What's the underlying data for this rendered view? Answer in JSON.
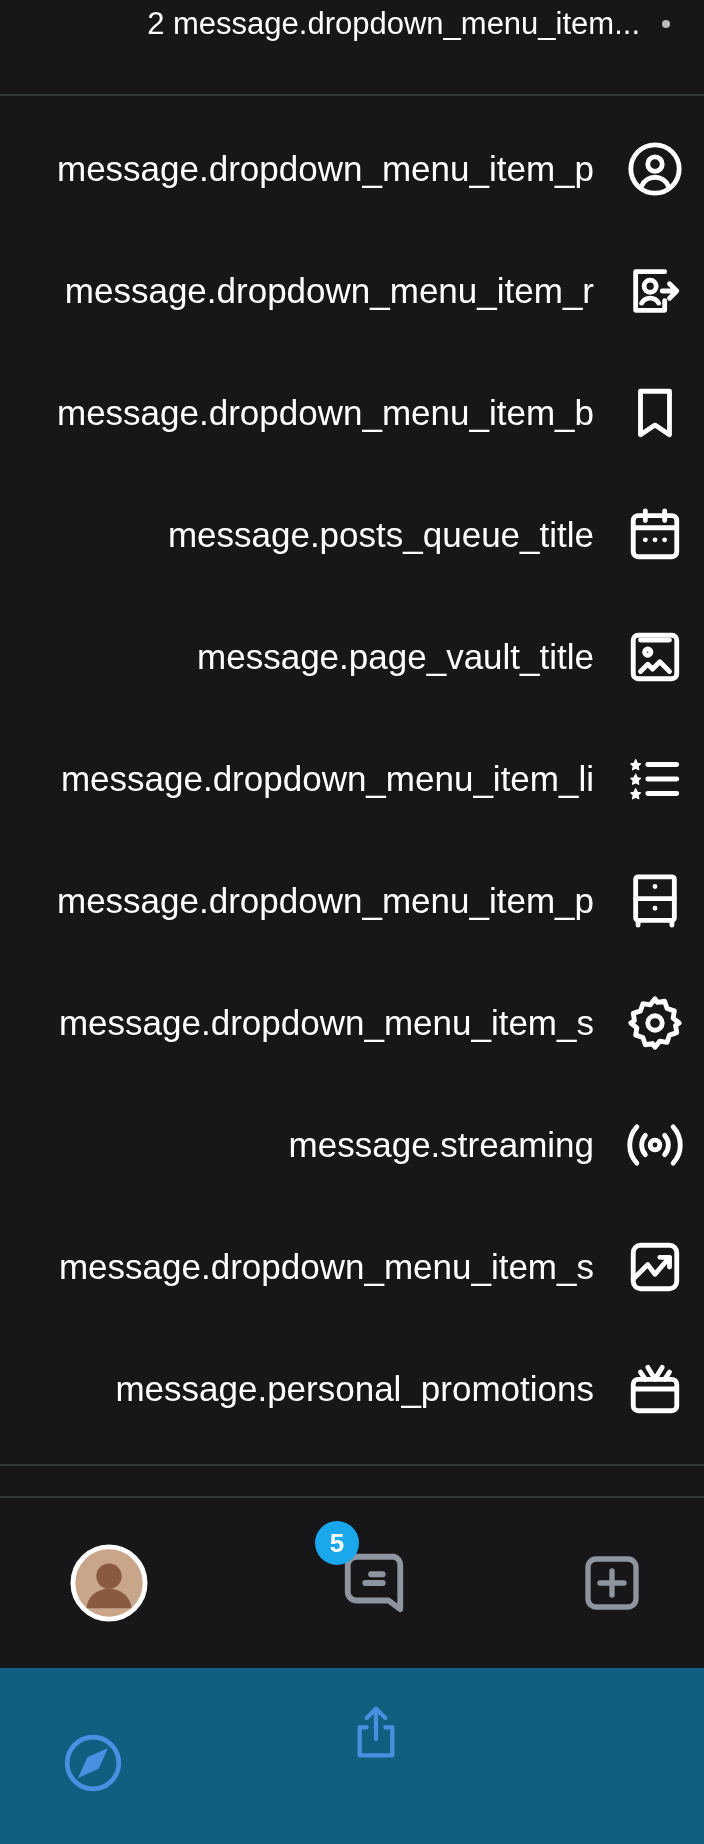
{
  "header": {
    "title": "2 message.dropdown_menu_item..."
  },
  "menu": {
    "items": [
      {
        "label": "message.dropdown_menu_item_p",
        "kind": "profile"
      },
      {
        "label": "message.dropdown_menu_item_r",
        "kind": "switch"
      },
      {
        "label": "message.dropdown_menu_item_b",
        "kind": "bookmark"
      },
      {
        "label": "message.posts_queue_title",
        "kind": "calendar"
      },
      {
        "label": "message.page_vault_title",
        "kind": "vault"
      },
      {
        "label": "message.dropdown_menu_item_li",
        "kind": "lists"
      },
      {
        "label": "message.dropdown_menu_item_p",
        "kind": "drawer"
      },
      {
        "label": "message.dropdown_menu_item_s",
        "kind": "settings"
      },
      {
        "label": "message.streaming",
        "kind": "streaming"
      },
      {
        "label": "message.dropdown_menu_item_s",
        "kind": "stats"
      },
      {
        "label": "message.personal_promotions",
        "kind": "gift"
      }
    ]
  },
  "bottom_nav": {
    "messages_badge": "5"
  }
}
